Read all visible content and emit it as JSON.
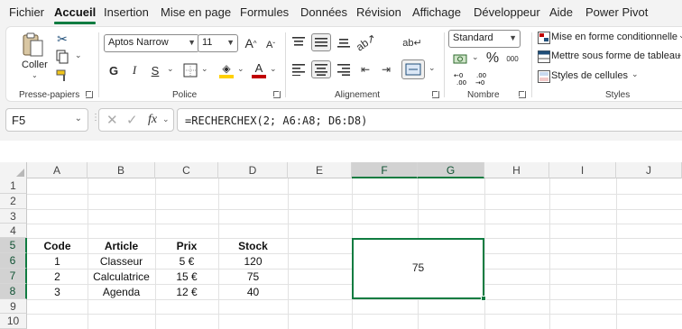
{
  "menu": {
    "tabs": [
      "Fichier",
      "Accueil",
      "Insertion",
      "Mise en page",
      "Formules",
      "Données",
      "Révision",
      "Affichage",
      "Développeur",
      "Aide",
      "Power Pivot"
    ],
    "active": "Accueil"
  },
  "ribbon": {
    "clipboard": {
      "paste_label": "Coller",
      "group_label": "Presse-papiers"
    },
    "font": {
      "font_name": "Aptos Narrow",
      "font_size": "11",
      "grow_label": "A",
      "shrink_label": "A",
      "bold": "G",
      "italic": "I",
      "underline": "S",
      "font_color_label": "A",
      "group_label": "Police"
    },
    "alignment": {
      "group_label": "Alignement"
    },
    "number": {
      "format": "Standard",
      "percent": "%",
      "thousands": "000",
      "group_label": "Nombre"
    },
    "styles": {
      "conditional": "Mise en forme conditionnelle",
      "table": "Mettre sous forme de tableau",
      "cell_styles": "Styles de cellules",
      "group_label": "Styles"
    }
  },
  "formula_bar": {
    "name_box": "F5",
    "fx": "fx",
    "formula": "=RECHERCHEX(2; A6:A8; D6:D8)"
  },
  "grid": {
    "columns": [
      "A",
      "B",
      "C",
      "D",
      "E",
      "F",
      "G",
      "H",
      "I",
      "J"
    ],
    "rows": [
      "1",
      "2",
      "3",
      "4",
      "5",
      "6",
      "7",
      "8",
      "9",
      "10"
    ],
    "selected_columns": [
      "F",
      "G"
    ],
    "selected_rows": [
      "5",
      "6",
      "7",
      "8"
    ],
    "table": {
      "headers": [
        "Code",
        "Article",
        "Prix",
        "Stock"
      ],
      "rows": [
        [
          "1",
          "Classeur",
          "5 €",
          "120"
        ],
        [
          "2",
          "Calculatrice",
          "15 €",
          "75"
        ],
        [
          "3",
          "Agenda",
          "12 €",
          "40"
        ]
      ]
    },
    "result_value": "75"
  },
  "colors": {
    "accent": "#107c41",
    "font_color": "#c00000",
    "fill_color": "#ffd000"
  }
}
